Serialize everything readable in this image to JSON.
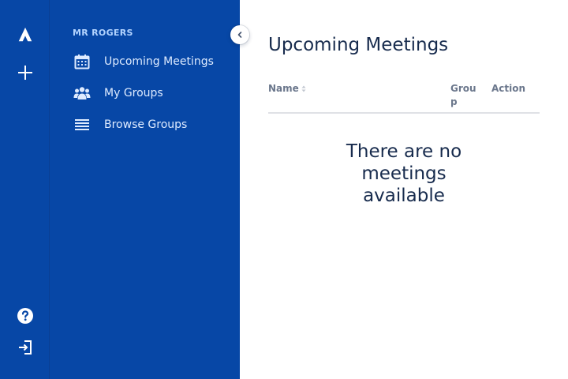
{
  "global_nav": {
    "logo_icon": "atlassian-logo-icon",
    "create_icon": "plus-icon",
    "help_icon": "question-circle-icon",
    "logout_icon": "sign-out-icon"
  },
  "sidebar": {
    "user_name": "MR ROGERS",
    "items": [
      {
        "label": "Upcoming Meetings",
        "icon": "calendar-icon"
      },
      {
        "label": "My Groups",
        "icon": "people-group-icon"
      },
      {
        "label": "Browse Groups",
        "icon": "list-icon"
      }
    ],
    "collapse_icon": "chevron-left-icon"
  },
  "main": {
    "title": "Upcoming Meetings",
    "table": {
      "columns": [
        "Name",
        "Group",
        "Action"
      ]
    },
    "empty_message": "There are no meetings available"
  },
  "colors": {
    "nav_background": "#0747a6",
    "nav_text": "#deebff",
    "user_label": "#b3d4ff",
    "title_text": "#172b4d",
    "header_text": "#6b778c",
    "divider": "#dfe1e6"
  }
}
